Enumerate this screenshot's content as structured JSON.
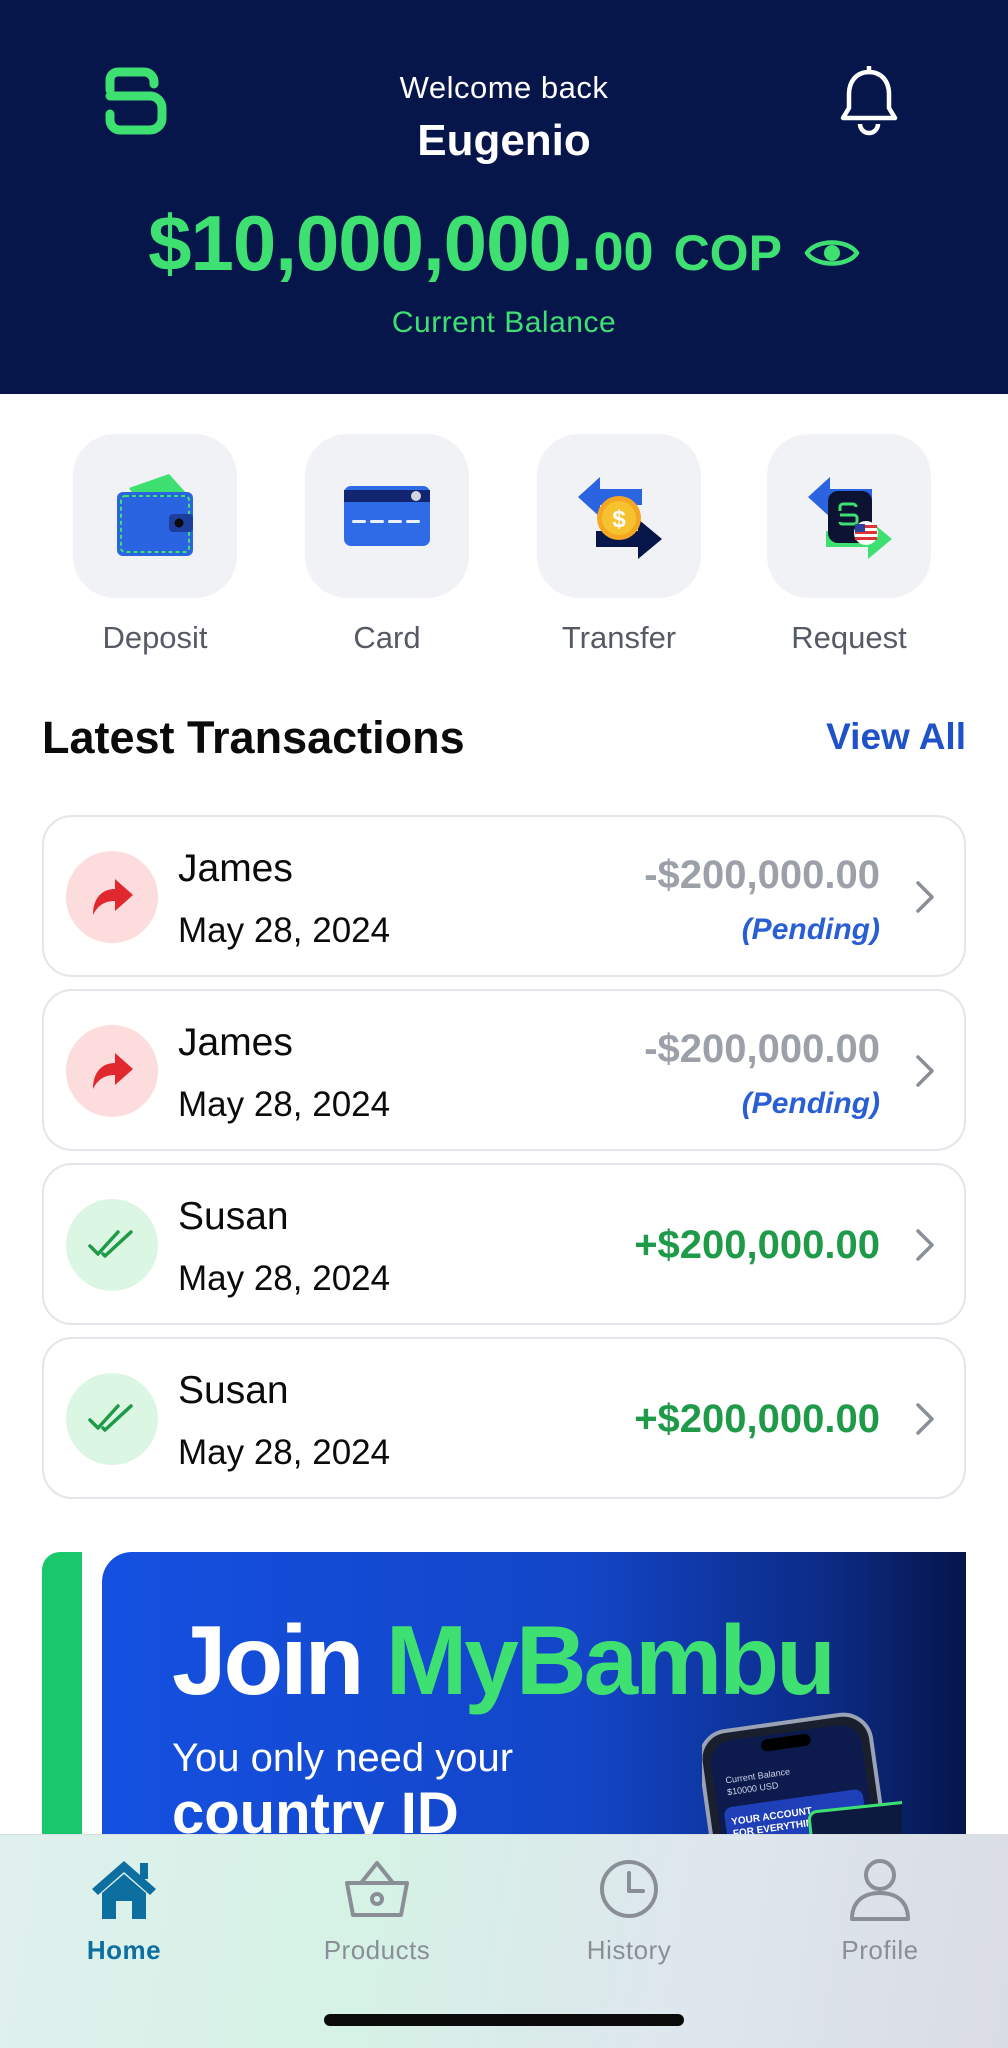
{
  "header": {
    "welcome": "Welcome back",
    "username": "Eugenio",
    "balance_main": "$10,000,000.",
    "balance_cents": "00",
    "balance_currency": "COP",
    "balance_label": "Current Balance",
    "icons": {
      "logo": "mybambu-logo-icon",
      "notifications": "bell-icon",
      "visibility": "eye-icon"
    },
    "colors": {
      "background": "#06154a",
      "accent": "#3ee071"
    }
  },
  "actions": [
    {
      "label": "Deposit",
      "icon": "wallet-icon"
    },
    {
      "label": "Card",
      "icon": "credit-card-icon"
    },
    {
      "label": "Transfer",
      "icon": "transfer-arrows-icon"
    },
    {
      "label": "Request",
      "icon": "request-arrows-icon"
    }
  ],
  "transactions_section": {
    "title": "Latest Transactions",
    "view_all": "View All",
    "items": [
      {
        "name": "James",
        "date": "May 28, 2024",
        "amount": "-$200,000.00",
        "status": "(Pending)",
        "direction": "out"
      },
      {
        "name": "James",
        "date": "May 28, 2024",
        "amount": "-$200,000.00",
        "status": "(Pending)",
        "direction": "out"
      },
      {
        "name": "Susan",
        "date": "May 28, 2024",
        "amount": "+$200,000.00",
        "status": "",
        "direction": "in"
      },
      {
        "name": "Susan",
        "date": "May 28, 2024",
        "amount": "+$200,000.00",
        "status": "",
        "direction": "in"
      }
    ],
    "colors": {
      "negative": "#9ca0a8",
      "positive": "#1f9a48",
      "pending": "#2a5fd4",
      "link": "#1f52c8"
    }
  },
  "banner": {
    "join": "Join",
    "brand": "MyBambu",
    "line1": "You only need your",
    "line2": "country ID",
    "phone_balance_label": "Current Balance",
    "phone_balance_value": "$10000 USD",
    "phone_card_text_1": "YOUR ACCOUNT",
    "phone_card_text_2": "FOR EVERYTHING"
  },
  "tabbar": {
    "tabs": [
      {
        "label": "Home",
        "icon": "home-icon",
        "active": true
      },
      {
        "label": "Products",
        "icon": "basket-icon",
        "active": false
      },
      {
        "label": "History",
        "icon": "clock-icon",
        "active": false
      },
      {
        "label": "Profile",
        "icon": "user-icon",
        "active": false
      }
    ],
    "colors": {
      "active": "#0d6ea0",
      "inactive": "#8a8f97"
    }
  }
}
